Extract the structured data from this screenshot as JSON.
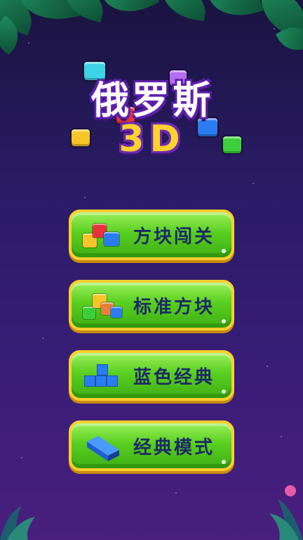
{
  "game": {
    "title_line1": "俄罗斯",
    "title_line2": "3D"
  },
  "menu": [
    {
      "label": "方块闯关",
      "icon": "gem-cluster-icon"
    },
    {
      "label": "标准方块",
      "icon": "gem-cluster-icon"
    },
    {
      "label": "蓝色经典",
      "icon": "blue-tetromino-icon"
    },
    {
      "label": "经典模式",
      "icon": "blue-3d-block-icon"
    }
  ],
  "colors": {
    "button_green": "#58cf20",
    "button_border": "#ffcf2d",
    "label_navy": "#1d2a66",
    "title_yellow": "#ffd22e",
    "background_purple": "#2a1b66"
  }
}
